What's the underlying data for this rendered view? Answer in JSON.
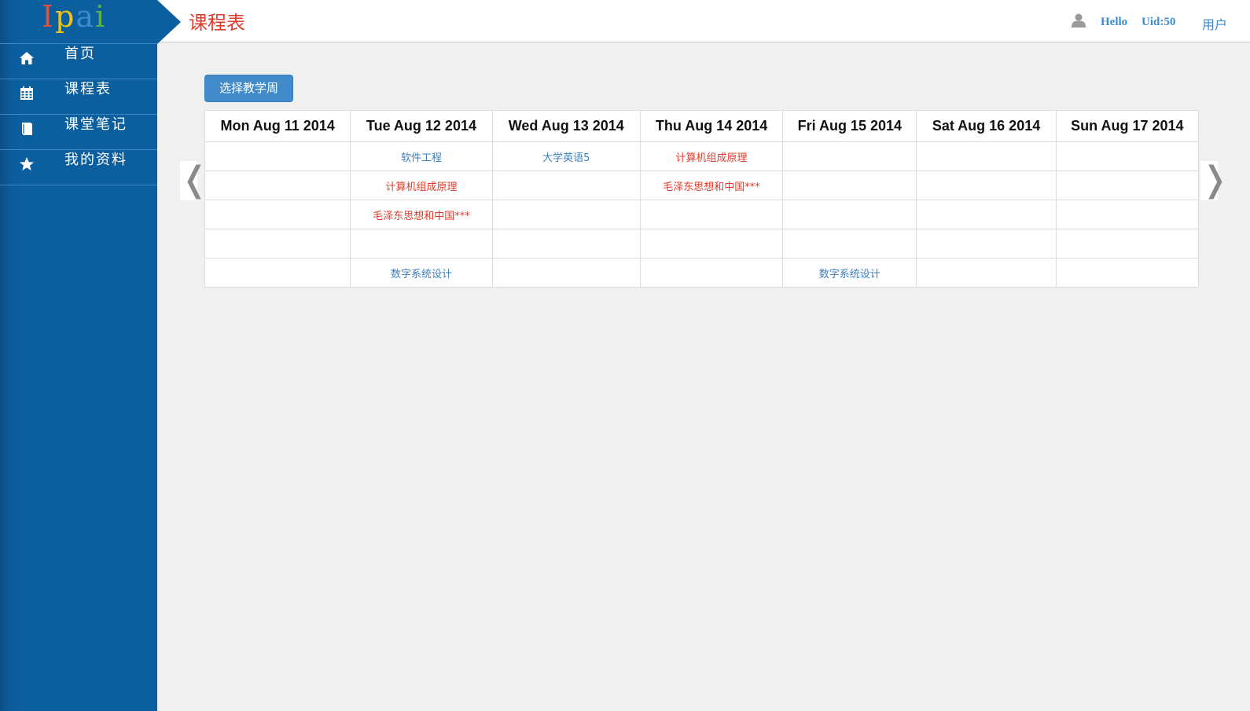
{
  "app": {
    "logo_letters": [
      {
        "char": "I",
        "color": "#e84c3d"
      },
      {
        "char": "p",
        "color": "#f4c20d"
      },
      {
        "char": "a",
        "color": "#3b8bd0"
      },
      {
        "char": "i",
        "color": "#58b44a"
      }
    ]
  },
  "sidebar": {
    "items": [
      {
        "label": "首页",
        "icon": "home-icon"
      },
      {
        "label": "课程表",
        "icon": "calendar-icon"
      },
      {
        "label": "课堂笔记",
        "icon": "book-icon"
      },
      {
        "label": "我的资料",
        "icon": "star-icon"
      }
    ]
  },
  "header": {
    "title": "课程表",
    "hello": "Hello",
    "uid": "Uid:50",
    "user_link": "用户",
    "user_icon": "user-icon"
  },
  "toolbar": {
    "select_week_label": "选择教学周"
  },
  "nav_arrows": {
    "prev": "❬",
    "next": "❭"
  },
  "colors": {
    "sidebar_bg": "#0b5f9f",
    "title_red": "#e03b2b",
    "link_blue": "#3b7fbd",
    "button_blue": "#428bca"
  },
  "schedule": {
    "days": [
      "Mon Aug 11 2014",
      "Tue Aug 12 2014",
      "Wed Aug 13 2014",
      "Thu Aug 14 2014",
      "Fri Aug 15 2014",
      "Sat Aug 16 2014",
      "Sun Aug 17 2014"
    ],
    "rows": [
      [
        {
          "text": "",
          "color": ""
        },
        {
          "text": "软件工程",
          "color": "blue"
        },
        {
          "text": "大学英语5",
          "color": "blue"
        },
        {
          "text": "计算机组成原理",
          "color": "red"
        },
        {
          "text": "",
          "color": ""
        },
        {
          "text": "",
          "color": ""
        },
        {
          "text": "",
          "color": ""
        }
      ],
      [
        {
          "text": "",
          "color": ""
        },
        {
          "text": "计算机组成原理",
          "color": "red"
        },
        {
          "text": "",
          "color": ""
        },
        {
          "text": "毛泽东思想和中国***",
          "color": "red"
        },
        {
          "text": "",
          "color": ""
        },
        {
          "text": "",
          "color": ""
        },
        {
          "text": "",
          "color": ""
        }
      ],
      [
        {
          "text": "",
          "color": ""
        },
        {
          "text": "毛泽东思想和中国***",
          "color": "red"
        },
        {
          "text": "",
          "color": ""
        },
        {
          "text": "",
          "color": ""
        },
        {
          "text": "",
          "color": ""
        },
        {
          "text": "",
          "color": ""
        },
        {
          "text": "",
          "color": ""
        }
      ],
      [
        {
          "text": "",
          "color": ""
        },
        {
          "text": "",
          "color": ""
        },
        {
          "text": "",
          "color": ""
        },
        {
          "text": "",
          "color": ""
        },
        {
          "text": "",
          "color": ""
        },
        {
          "text": "",
          "color": ""
        },
        {
          "text": "",
          "color": ""
        }
      ],
      [
        {
          "text": "",
          "color": ""
        },
        {
          "text": "数字系统设计",
          "color": "blue"
        },
        {
          "text": "",
          "color": ""
        },
        {
          "text": "",
          "color": ""
        },
        {
          "text": "数字系统设计",
          "color": "blue"
        },
        {
          "text": "",
          "color": ""
        },
        {
          "text": "",
          "color": ""
        }
      ]
    ]
  }
}
